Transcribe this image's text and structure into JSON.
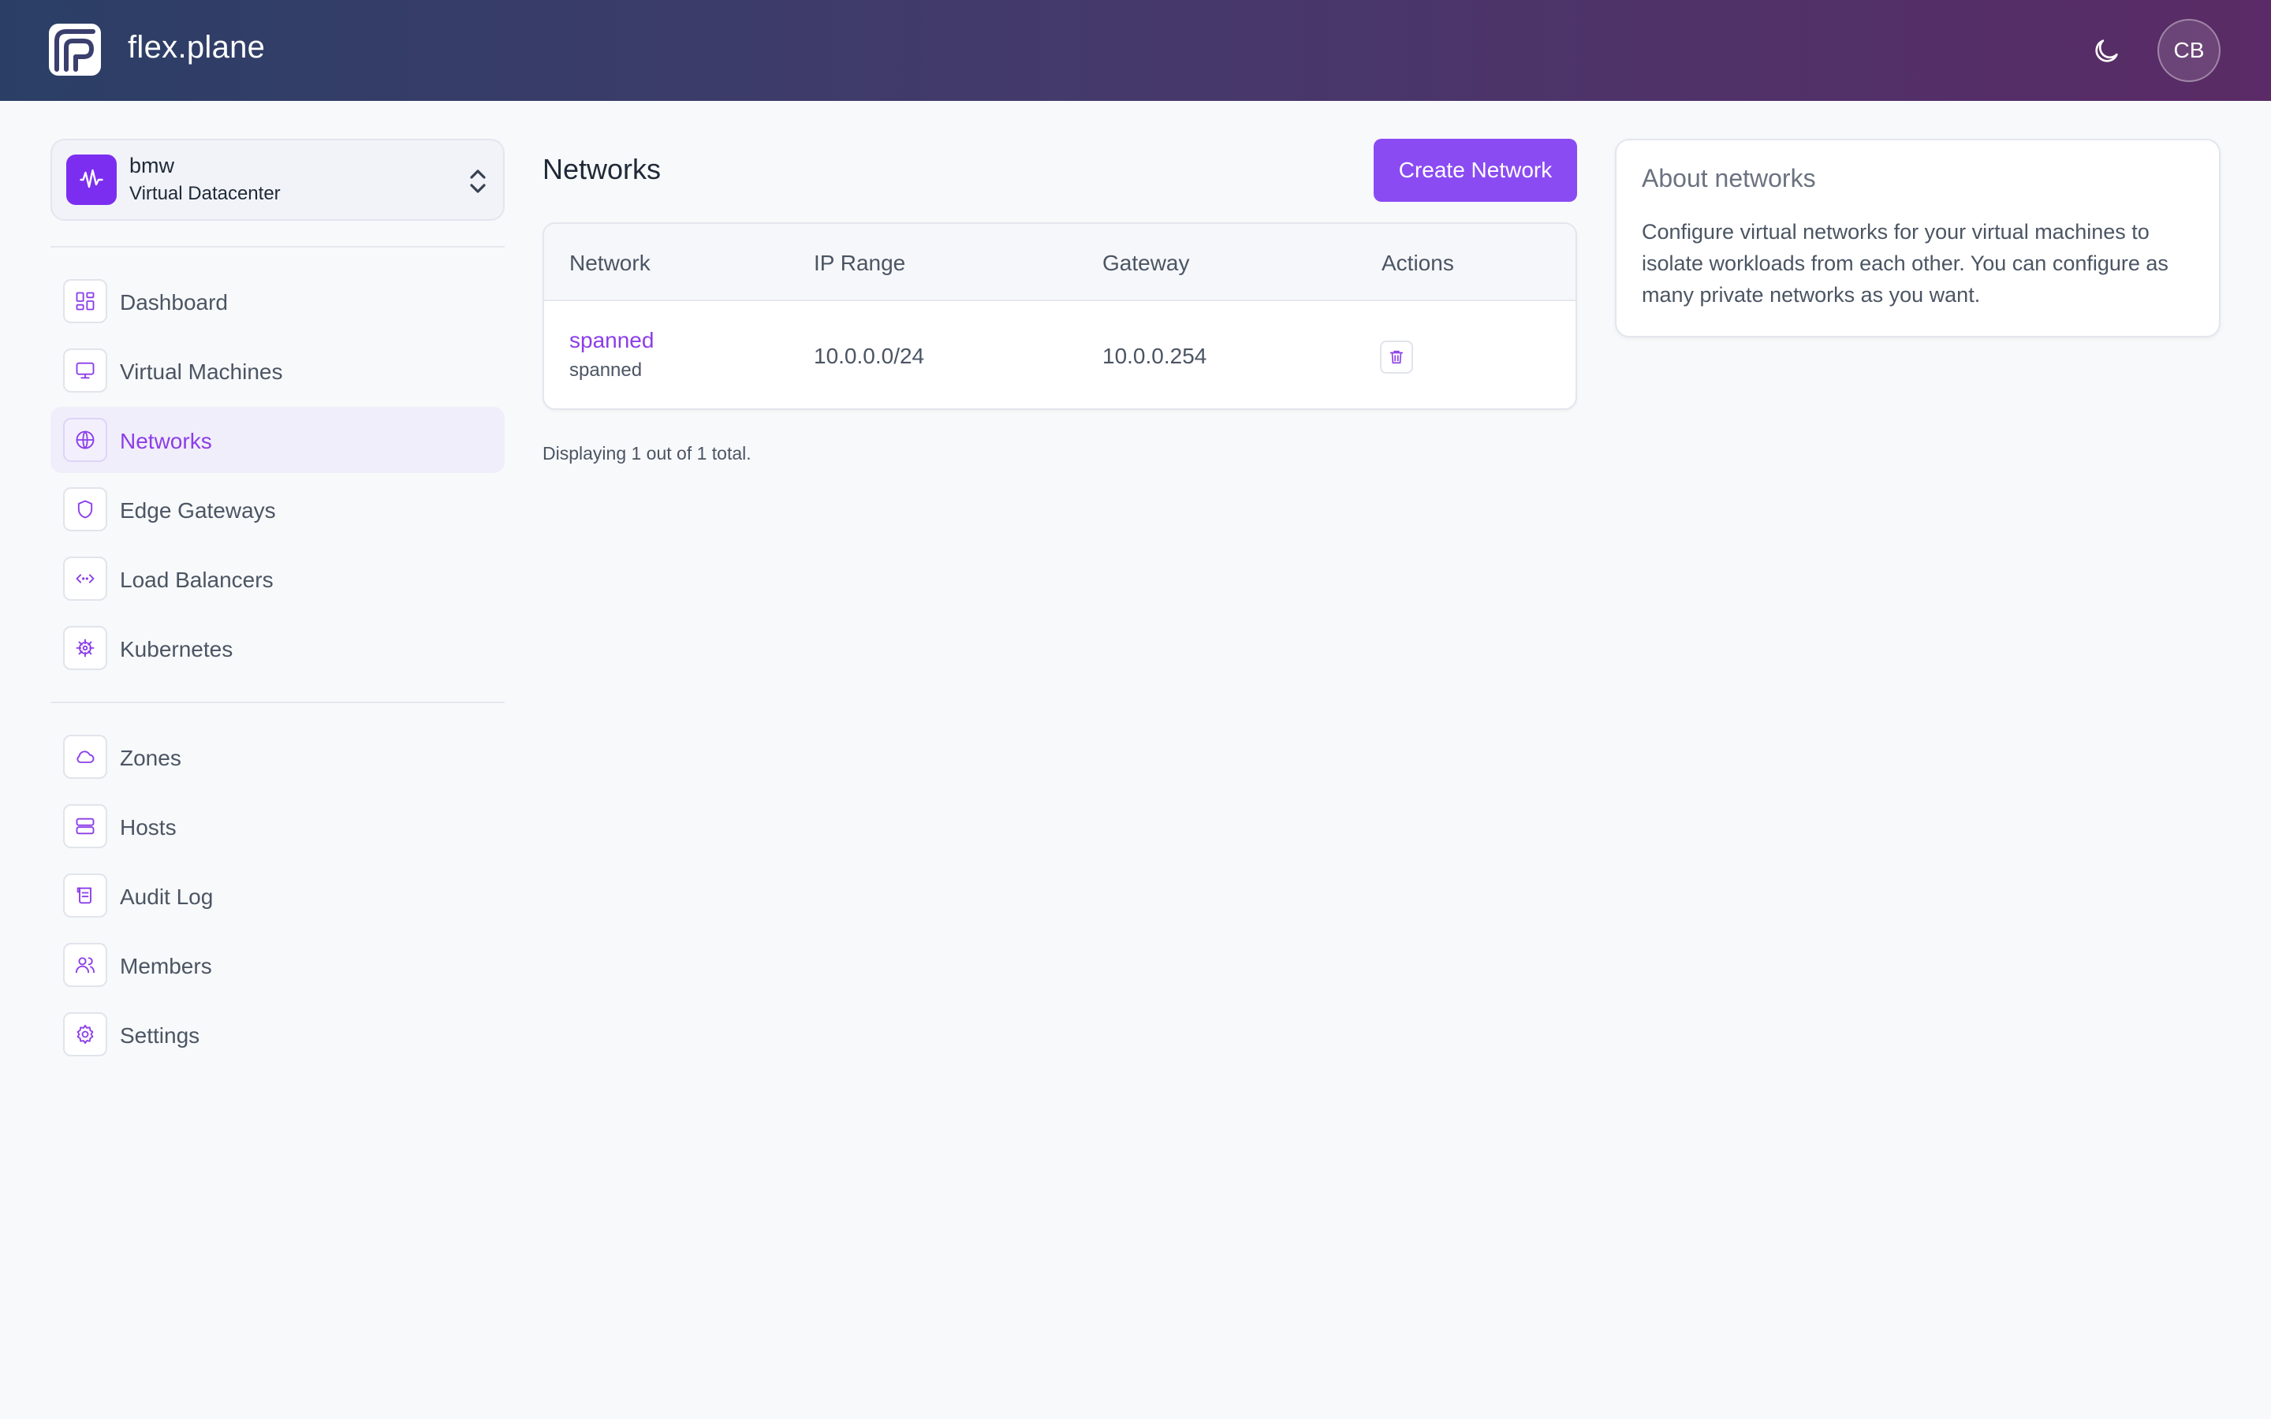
{
  "header": {
    "brand": "flex.plane",
    "user_initials": "CB"
  },
  "datacenter": {
    "name": "bmw",
    "type": "Virtual Datacenter"
  },
  "sidebar": {
    "primary": [
      {
        "label": "Dashboard",
        "icon": "dashboard-icon"
      },
      {
        "label": "Virtual Machines",
        "icon": "monitor-icon"
      },
      {
        "label": "Networks",
        "icon": "globe-icon",
        "active": true
      },
      {
        "label": "Edge Gateways",
        "icon": "shield-icon"
      },
      {
        "label": "Load Balancers",
        "icon": "code-arrows-icon"
      },
      {
        "label": "Kubernetes",
        "icon": "helm-icon"
      }
    ],
    "secondary": [
      {
        "label": "Zones",
        "icon": "cloud-icon"
      },
      {
        "label": "Hosts",
        "icon": "server-icon"
      },
      {
        "label": "Audit Log",
        "icon": "scroll-icon"
      },
      {
        "label": "Members",
        "icon": "users-icon"
      },
      {
        "label": "Settings",
        "icon": "gear-icon"
      }
    ]
  },
  "main": {
    "title": "Networks",
    "create_label": "Create Network",
    "table": {
      "columns": [
        "Network",
        "IP Range",
        "Gateway",
        "Actions"
      ],
      "rows": [
        {
          "name": "spanned",
          "subtitle": "spanned",
          "ip_range": "10.0.0.0/24",
          "gateway": "10.0.0.254"
        }
      ]
    },
    "footer": "Displaying 1 out of 1 total."
  },
  "about": {
    "title": "About networks",
    "body": "Configure virtual networks for your virtual machines to isolate workloads from each other. You can configure as many private networks as you want."
  },
  "colors": {
    "accent": "#8a4bf3",
    "active_text": "#8b3ee8",
    "datacenter_badge": "#7c2ef0"
  }
}
